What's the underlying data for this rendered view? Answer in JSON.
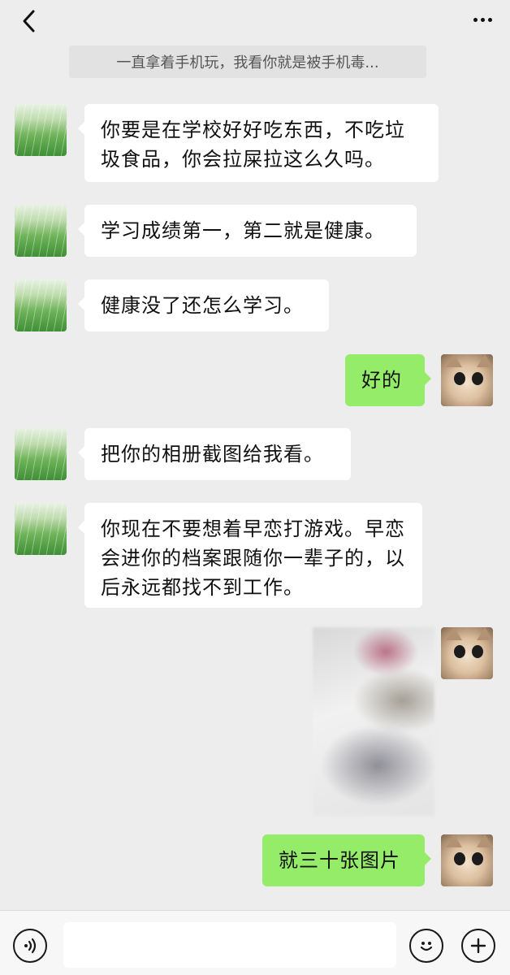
{
  "header": {
    "title": "",
    "back_icon": "chevron-left-icon",
    "more_icon": "more-horizontal-icon"
  },
  "pinned_preview": "一直拿着手机玩，我看你就是被手机毒...",
  "messages": [
    {
      "side": "left",
      "avatar": "grass-avatar",
      "text": "你要是在学校好好吃东西，不吃垃圾食品，你会拉屎拉这么久吗。"
    },
    {
      "side": "left",
      "avatar": "grass-avatar",
      "text": "学习成绩第一，第二就是健康。"
    },
    {
      "side": "left",
      "avatar": "grass-avatar",
      "text": "健康没了还怎么学习。"
    },
    {
      "side": "right",
      "avatar": "cat-avatar",
      "text": "好的"
    },
    {
      "side": "left",
      "avatar": "grass-avatar",
      "text": "把你的相册截图给我看。"
    },
    {
      "side": "left",
      "avatar": "grass-avatar",
      "text": "你现在不要想着早恋打游戏。早恋会进你的档案跟随你一辈子的，以后永远都找不到工作。"
    },
    {
      "side": "right",
      "avatar": "cat-avatar",
      "type": "image",
      "text": ""
    },
    {
      "side": "right",
      "avatar": "cat-avatar",
      "text": "就三十张图片"
    }
  ],
  "input_bar": {
    "placeholder": "",
    "voice_icon": "voice-icon",
    "emoji_icon": "emoji-icon",
    "plus_icon": "plus-circle-icon"
  },
  "colors": {
    "background": "#ededed",
    "bubble_left": "#ffffff",
    "bubble_right": "#95ec69"
  }
}
